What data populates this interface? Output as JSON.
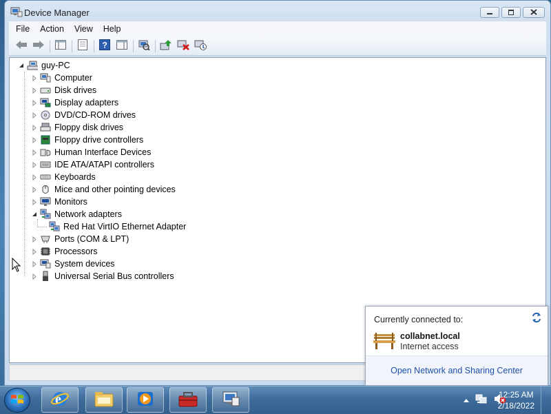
{
  "window": {
    "title": "Device Manager",
    "icon": "device-manager-icon",
    "caption_buttons": [
      "minimize-icon",
      "maximize-icon",
      "close-icon"
    ]
  },
  "menu": [
    "File",
    "Action",
    "View",
    "Help"
  ],
  "toolbar": {
    "buttons": [
      "back-arrow-icon",
      "forward-arrow-icon",
      "show-hide-console-tree-icon",
      "properties-icon",
      "help-icon",
      "action-pane-icon",
      "scan-hardware-icon",
      "update-driver-icon",
      "uninstall-icon",
      "disable-icon"
    ]
  },
  "tree": {
    "root": "guy-PC",
    "categories": [
      {
        "label": "Computer",
        "icon": "computer-icon"
      },
      {
        "label": "Disk drives",
        "icon": "disk-drive-icon"
      },
      {
        "label": "Display adapters",
        "icon": "display-adapter-icon"
      },
      {
        "label": "DVD/CD-ROM drives",
        "icon": "dvd-drive-icon"
      },
      {
        "label": "Floppy disk drives",
        "icon": "floppy-disk-icon"
      },
      {
        "label": "Floppy drive controllers",
        "icon": "floppy-controller-icon"
      },
      {
        "label": "Human Interface Devices",
        "icon": "hid-icon"
      },
      {
        "label": "IDE ATA/ATAPI controllers",
        "icon": "ide-controller-icon"
      },
      {
        "label": "Keyboards",
        "icon": "keyboard-icon"
      },
      {
        "label": "Mice and other pointing devices",
        "icon": "mouse-icon"
      },
      {
        "label": "Monitors",
        "icon": "monitor-icon"
      },
      {
        "label": "Network adapters",
        "icon": "network-adapter-icon",
        "expanded": true
      },
      {
        "label": "Red Hat VirtIO Ethernet Adapter",
        "icon": "network-adapter-icon",
        "child": true
      },
      {
        "label": "Ports (COM & LPT)",
        "icon": "port-icon"
      },
      {
        "label": "Processors",
        "icon": "processor-icon"
      },
      {
        "label": "System devices",
        "icon": "system-device-icon"
      },
      {
        "label": "Universal Serial Bus controllers",
        "icon": "usb-icon"
      }
    ]
  },
  "network_popup": {
    "heading": "Currently connected to:",
    "network_name": "collabnet.local",
    "status": "Internet access",
    "link": "Open Network and Sharing Center"
  },
  "taskbar": {
    "pinned": [
      "internet-explorer-icon",
      "windows-explorer-icon",
      "media-player-icon",
      "toolbox-icon",
      "device-manager-icon"
    ],
    "tray_icons": [
      "show-hidden-icons-icon",
      "network-icon",
      "volume-muted-icon"
    ],
    "time": "12:25 AM",
    "date": "2/18/2022"
  },
  "colors": {
    "accent": "#1e4fa8",
    "taskbar": "#3e6c9b"
  }
}
